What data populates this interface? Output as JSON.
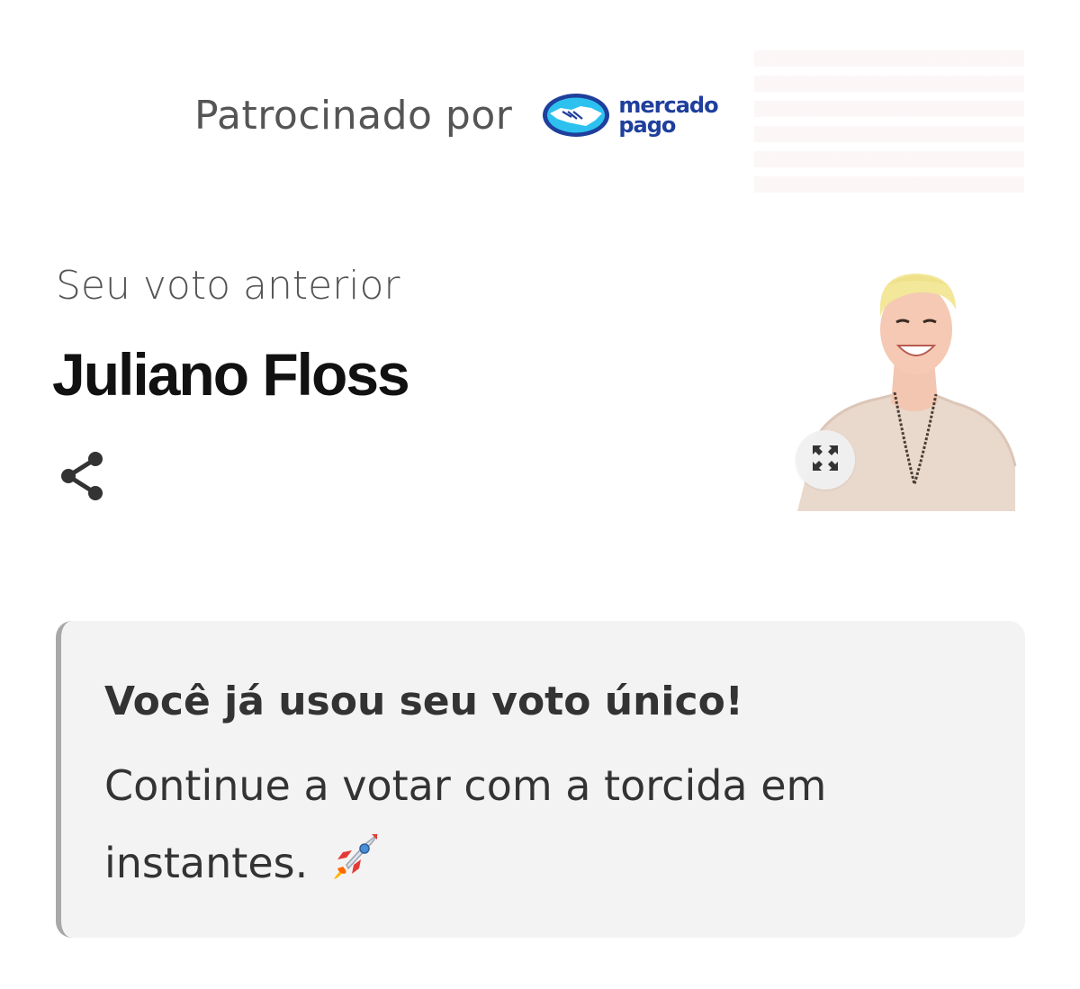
{
  "sponsor": {
    "label": "Patrocinado por",
    "brand_line1": "mercado",
    "brand_line2": "pago",
    "brand_color": "#1f3f9c",
    "brand_light": "#2dc1f0",
    "icon": "handshake-logo-icon"
  },
  "previous_vote": {
    "label": "Seu voto anterior",
    "name": "Juliano Floss",
    "share_icon": "share-icon",
    "expand_icon": "expand-icon"
  },
  "notice": {
    "title": "Você já usou seu voto único!",
    "body": "Continue a votar com a torcida em instantes.",
    "emoji": "rocket-icon"
  }
}
